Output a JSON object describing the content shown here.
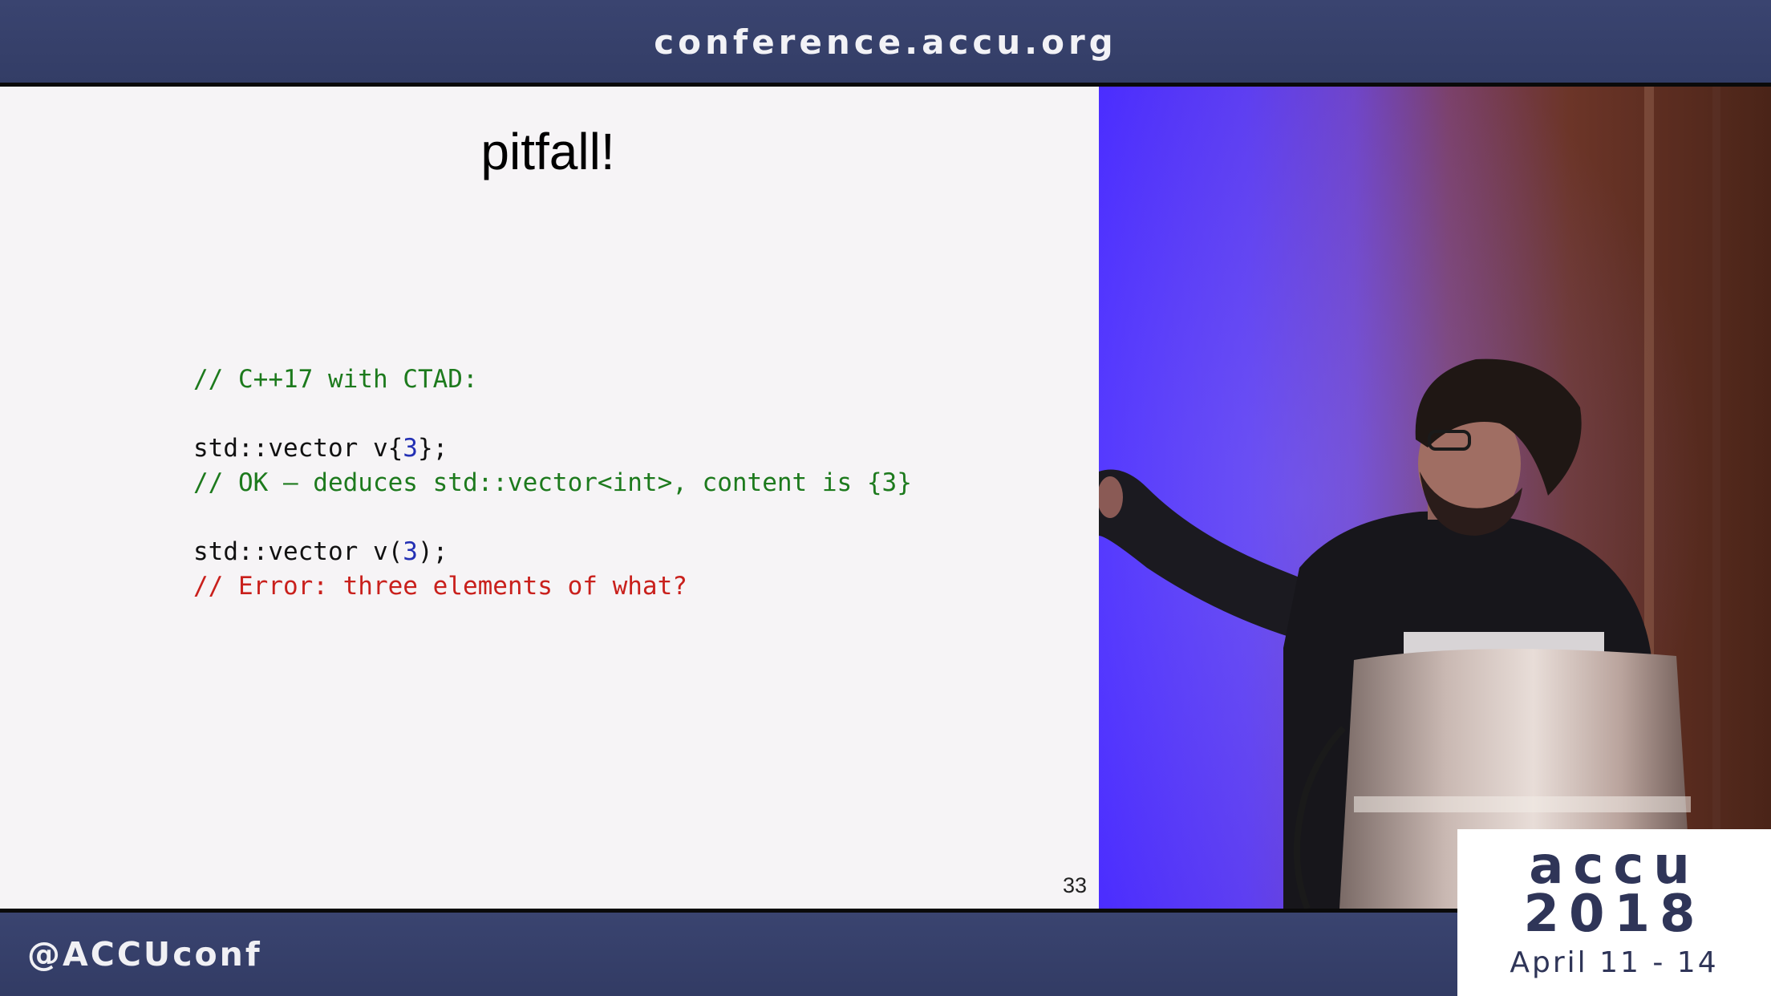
{
  "header": {
    "url": "conference.accu.org"
  },
  "slide": {
    "title": "pitfall!",
    "code": [
      {
        "comment": "// C++17 with CTAD:"
      },
      {
        "pre": "std::vector v{",
        "num": "3",
        "post": "};"
      },
      {
        "comment": "// OK – deduces std::vector<int>, content is {3}"
      },
      {
        "pre": "std::vector v(",
        "num": "3",
        "post": ");"
      },
      {
        "comment": "// Error: three elements of what?"
      }
    ],
    "page_number": "33"
  },
  "footer": {
    "handle": "@ACCUconf"
  },
  "logo": {
    "line1": "accu",
    "line2": "2018",
    "line3": "April 11 - 14"
  },
  "colors": {
    "header_bg": "#363f6a",
    "code_comment_green": "#1d7a1d",
    "code_comment_red": "#c9201c",
    "code_number": "#2330b4"
  }
}
